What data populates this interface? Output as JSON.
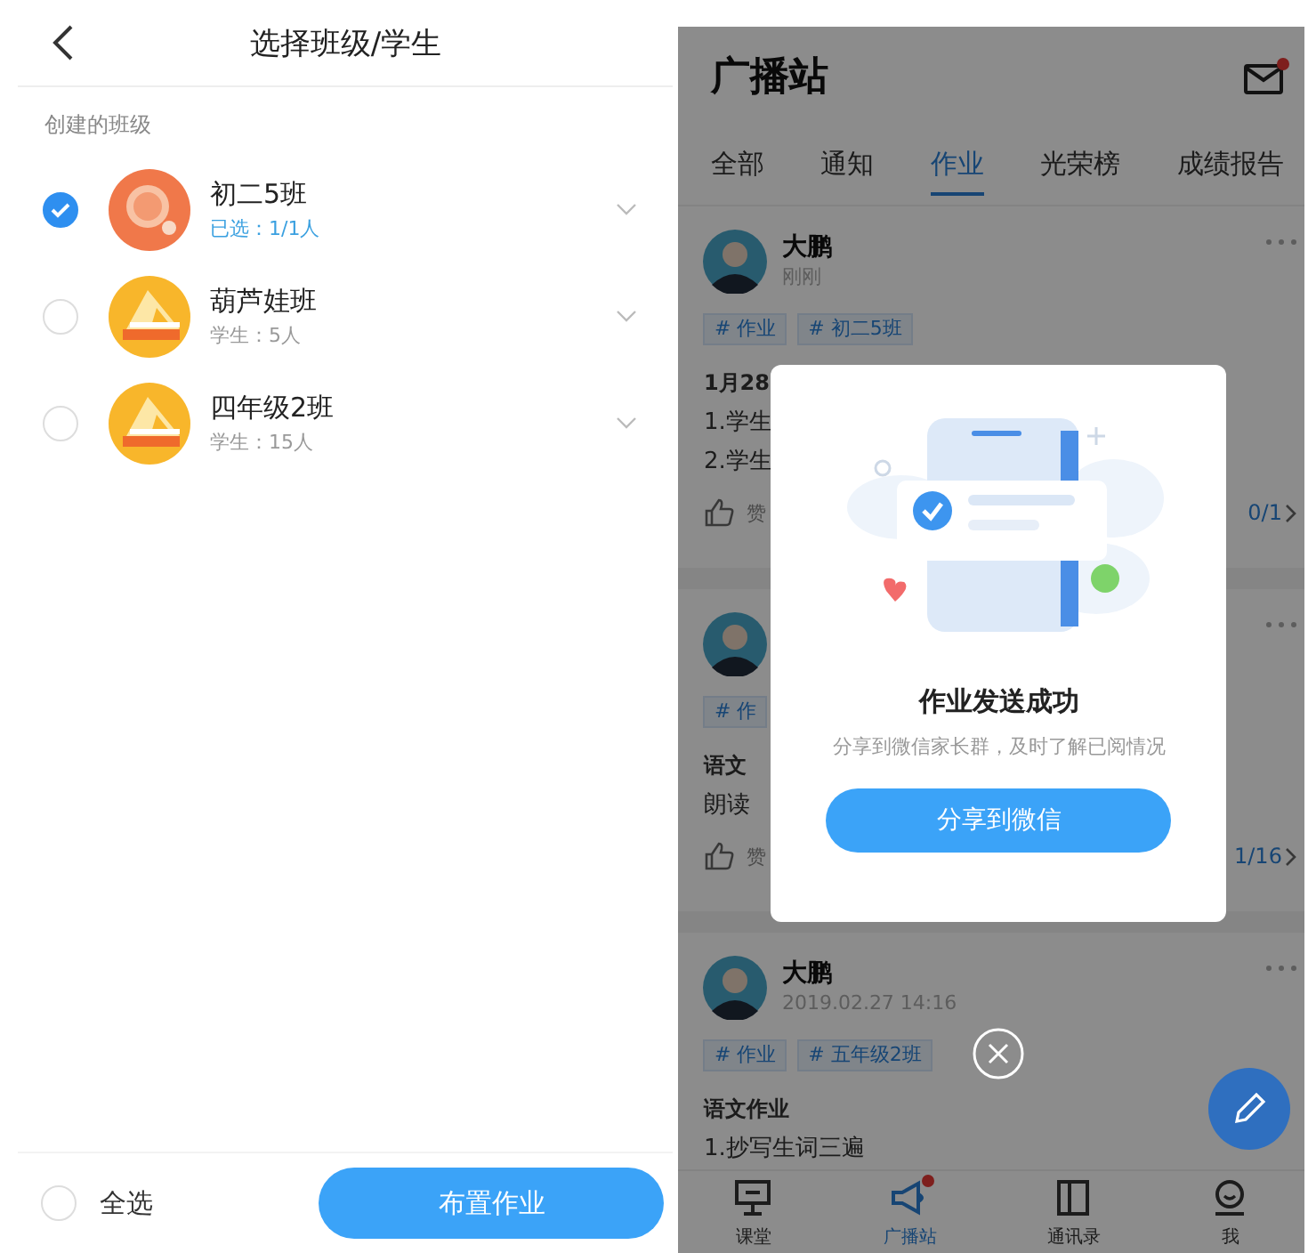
{
  "class_picker": {
    "title": "选择班级/学生",
    "section_label": "创建的班级",
    "classes": [
      {
        "name": "初二5班",
        "subtitle": "已选：1/1人",
        "selected": true,
        "kind": "magnifier"
      },
      {
        "name": "葫芦娃班",
        "subtitle": "学生：5人",
        "selected": false,
        "kind": "ruler"
      },
      {
        "name": "四年级2班",
        "subtitle": "学生：15人",
        "selected": false,
        "kind": "ruler"
      }
    ],
    "select_all": {
      "label": "全选",
      "checked": false
    },
    "assign_button": "布置作业"
  },
  "broadcast": {
    "title": "广播站",
    "mail_unread": true,
    "tabs": [
      {
        "label": "全部",
        "selected": false
      },
      {
        "label": "通知",
        "selected": false
      },
      {
        "label": "作业",
        "selected": true
      },
      {
        "label": "光荣榜",
        "selected": false
      },
      {
        "label": "成绩报告",
        "selected": false
      }
    ],
    "posts": [
      {
        "author": "大鹏",
        "time": "刚刚",
        "tags": [
          "# 作业",
          "# 初二5班"
        ],
        "lines": [
          {
            "text": "1月28",
            "bold": true
          },
          {
            "text": "1.学生",
            "bold": false
          },
          {
            "text": "2.学生",
            "bold": false
          }
        ],
        "like_label": "赞",
        "read_count": "0/1"
      },
      {
        "tags": [
          "# 作"
        ],
        "lines": [
          {
            "text": "语文",
            "bold": true
          },
          {
            "text": "朗读",
            "bold": false
          }
        ],
        "like_label": "赞",
        "read_count": "1/16"
      },
      {
        "author": "大鹏",
        "time": "2019.02.27 14:16",
        "tags": [
          "# 作业",
          "# 五年级2班"
        ],
        "lines": [
          {
            "text": "语文作业",
            "bold": true
          },
          {
            "text": "1.抄写生词三遍",
            "bold": false
          }
        ]
      }
    ],
    "dialog": {
      "title": "作业发送成功",
      "message": "分享到微信家长群，及时了解已阅情况",
      "button": "分享到微信"
    },
    "nav": [
      {
        "label": "课堂",
        "selected": false,
        "badge": false
      },
      {
        "label": "广播站",
        "selected": true,
        "badge": true
      },
      {
        "label": "通讯录",
        "selected": false,
        "badge": false
      },
      {
        "label": "我",
        "selected": false,
        "badge": false
      }
    ]
  }
}
